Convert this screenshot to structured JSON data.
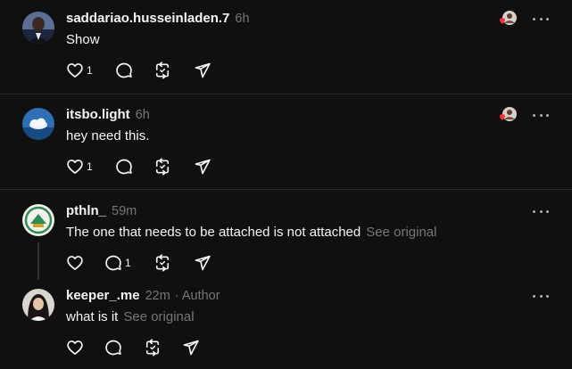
{
  "posts": [
    {
      "username": "saddariao.husseinladen.7",
      "time": "6h",
      "text": "Show",
      "like_count": "1",
      "has_liked_badge": true,
      "avatar": "man-portrait-avatar"
    },
    {
      "username": "itsbo.light",
      "time": "6h",
      "text": "hey need this.",
      "like_count": "1",
      "has_liked_badge": true,
      "avatar": "cloud-avatar"
    },
    {
      "username": "pthln_",
      "time": "59m",
      "text": "The one that needs to be attached is not attached",
      "see_original": "See original",
      "reply_count": "1",
      "avatar": "green-logo-avatar"
    },
    {
      "username": "keeper_.me",
      "time": "22m",
      "meta_extra": "· Author",
      "text": "what is it",
      "see_original": "See original",
      "avatar": "woman-portrait-avatar"
    }
  ],
  "colors": {
    "background": "#101010",
    "text": "#f3f5f7",
    "muted": "#777777",
    "like_red": "#ff3040"
  }
}
